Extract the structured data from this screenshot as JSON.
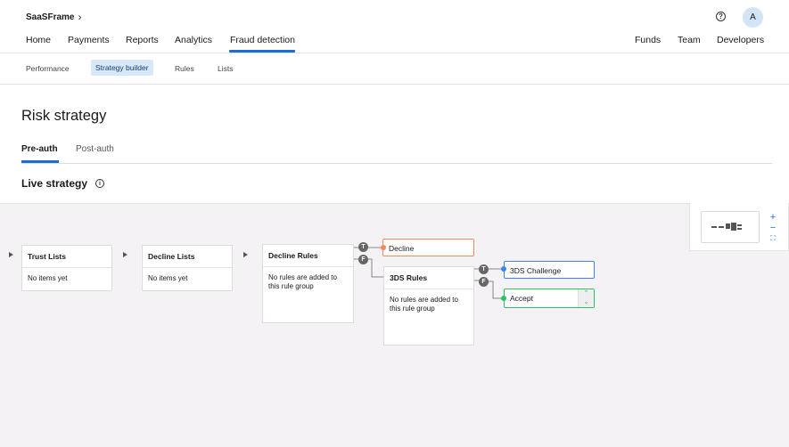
{
  "header": {
    "brand": "SaaSFrame",
    "avatar_letter": "A",
    "help_glyph": "?",
    "nav_left": [
      "Home",
      "Payments",
      "Reports",
      "Analytics",
      "Fraud detection"
    ],
    "nav_right": [
      "Funds",
      "Team",
      "Developers"
    ],
    "active_nav": "Fraud detection"
  },
  "subnav": {
    "items": [
      "Performance",
      "Strategy builder",
      "Rules",
      "Lists"
    ],
    "active": "Strategy builder"
  },
  "page": {
    "title": "Risk strategy",
    "tabs": [
      "Pre-auth",
      "Post-auth"
    ],
    "active_tab": "Pre-auth",
    "section_title": "Live strategy",
    "info_glyph": "i"
  },
  "flow": {
    "trust_lists": {
      "title": "Trust Lists",
      "body": "No items yet"
    },
    "decline_lists": {
      "title": "Decline Lists",
      "body": "No items yet"
    },
    "decline_rules": {
      "title": "Decline Rules",
      "body": "No rules are added to this rule group"
    },
    "three_ds_rules": {
      "title": "3DS Rules",
      "body": "No rules are added to this rule group"
    },
    "outcomes": {
      "decline": "Decline",
      "challenge": "3DS Challenge",
      "accept": "Accept"
    },
    "true_badge": "T",
    "false_badge": "F"
  },
  "zoom": {
    "in": "+",
    "out": "−",
    "fit": "⛶"
  },
  "colors": {
    "accent": "#1a6fd6",
    "decline": "#f08a5d",
    "challenge": "#3b82f6",
    "accept": "#22c55e",
    "canvas": "#f5f2f5"
  },
  "icons": {
    "brand_chevron": "chevron-right-icon",
    "help": "help-circle-icon",
    "info": "info-circle-icon",
    "expand": "caret-right-icon",
    "zoom_in": "plus-icon",
    "zoom_out": "minus-icon",
    "fit": "fit-screen-icon",
    "select": "chevron-up-down-icon"
  }
}
